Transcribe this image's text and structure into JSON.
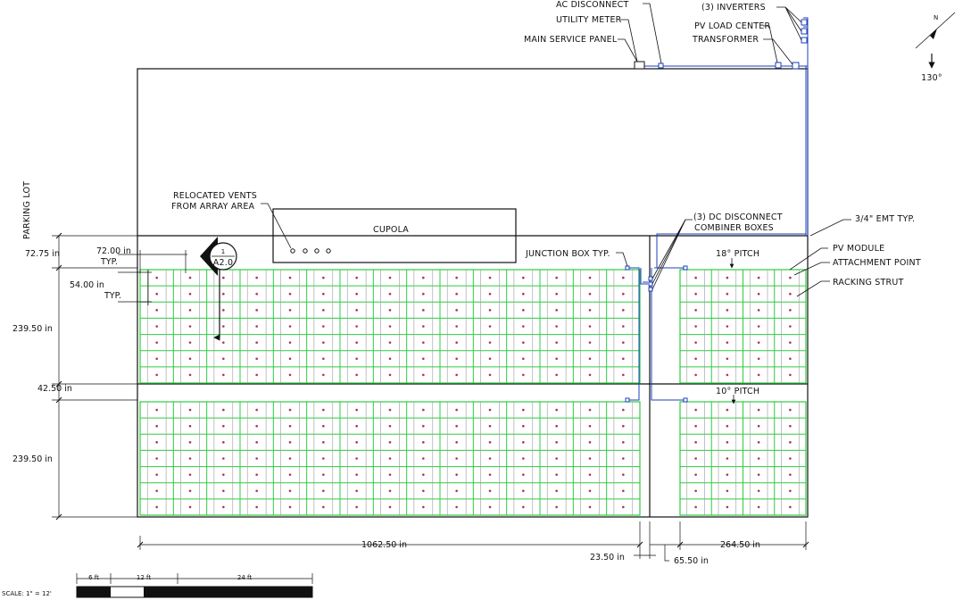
{
  "labels": {
    "ac_disconnect": "AC DISCONNECT",
    "utility_meter": "UTILITY METER",
    "main_service_panel": "MAIN SERVICE PANEL",
    "inverters": "(3) INVERTERS",
    "pv_load_center": "PV LOAD CENTER",
    "transformer": "TRANSFORMER",
    "parking_lot": "PARKING LOT",
    "relocated_vents_1": "RELOCATED VENTS",
    "relocated_vents_2": "FROM ARRAY AREA",
    "cupola": "CUPOLA",
    "section_marker_top": "1",
    "section_marker_bottom": "A2.0",
    "junction_box": "JUNCTION BOX TYP.",
    "dc_disconnect_1": "(3) DC DISCONNECT",
    "dc_disconnect_2": "COMBINER BOXES",
    "emt": "3/4\" EMT TYP.",
    "pitch_upper": "18° PITCH",
    "pitch_lower": "10° PITCH",
    "pv_module": "PV MODULE",
    "attachment_point": "ATTACHMENT POINT",
    "racking_strut": "RACKING STRUT",
    "north_arrow_letter": "N",
    "north_arrow_angle": "130°",
    "scale_label": "SCALE: 1\" = 12'"
  },
  "dimensions": {
    "d_72_75": "72.75 in",
    "d_72_00": "72.00 in",
    "d_typ1": "TYP.",
    "d_54_00": "54.00 in",
    "d_typ2": "TYP.",
    "d_239_50_a": "239.50 in",
    "d_42_50": "42.50 in",
    "d_239_50_b": "239.50 in",
    "d_1062_50": "1062.50 in",
    "d_23_50": "23.50 in",
    "d_65_50": "65.50 in",
    "d_264_50": "264.50 in"
  },
  "scale_bar": {
    "seg1": "6 ft",
    "seg2": "12 ft",
    "seg3": "24 ft"
  },
  "colors": {
    "module_green": "#2ecc40",
    "conduit_blue": "#1f3fbf",
    "attachment_red": "#b03060",
    "line_black": "#111111"
  }
}
